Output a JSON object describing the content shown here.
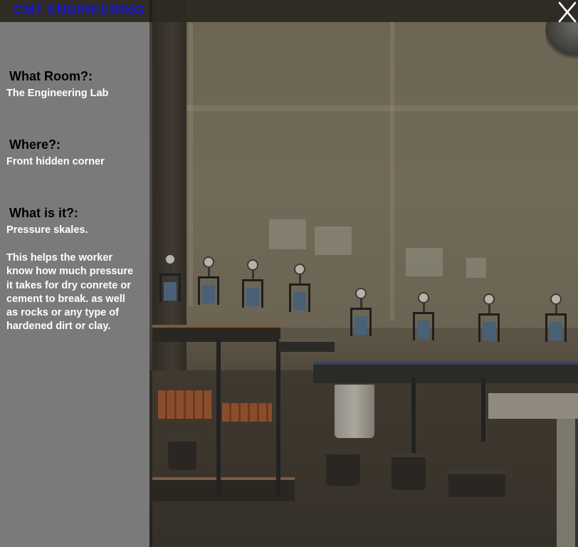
{
  "header": {
    "title": "CMT ENGINEERING",
    "close_icon": "close-x-icon",
    "close_glyph": "X"
  },
  "info_panel": {
    "sections": [
      {
        "question": "What Room?:",
        "answer": "The Engineering Lab"
      },
      {
        "question": "Where?:",
        "answer": "Front hidden corner"
      },
      {
        "question": "What is it?:",
        "answer": "Pressure skales."
      }
    ],
    "description": "This helps  the worker\nknow how much pressure\nit takes for dry conrete or\ncement  to break.   as well\nas rocks or any type of\nhardened dirt or clay."
  },
  "colors": {
    "title": "#1414d8",
    "panel_background": "#7a7a7a",
    "question_text": "#000000",
    "answer_text": "#ffffff"
  }
}
